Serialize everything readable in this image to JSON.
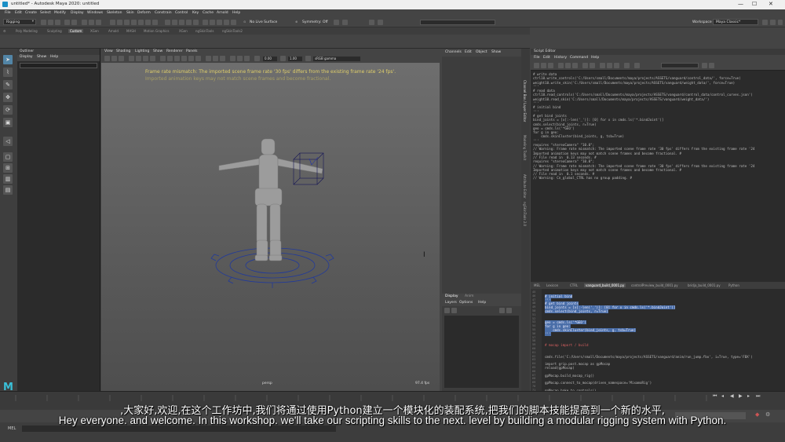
{
  "window": {
    "title": "untitled* - Autodesk Maya 2020: untitled",
    "controls": [
      "—",
      "☐",
      "✕"
    ]
  },
  "menubar": {
    "items": [
      "File",
      "Edit",
      "Create",
      "Select",
      "Modify",
      "Display",
      "Windows",
      "Skeleton",
      "Skin",
      "Deform",
      "Constrain",
      "Control",
      "Key",
      "Cache",
      "Arnold",
      "Help"
    ]
  },
  "statusline": {
    "mode": "Rigging",
    "live_surface": "No Live Surface",
    "symmetry": "Symmetry: Off",
    "workspace_label": "Workspace :",
    "workspace_value": "Maya Classic*"
  },
  "shelf_tabs": [
    "Poly Modeling",
    "Sculpting",
    "Custom",
    "XGen",
    "Arnold",
    "MASH",
    "Motion Graphics",
    "XGen",
    "ngSkinTools",
    "ngSkinTools2"
  ],
  "outliner": {
    "title": "Outliner",
    "menu": [
      "Display",
      "Show",
      "Help"
    ]
  },
  "viewport": {
    "menu": [
      "View",
      "Shading",
      "Lighting",
      "Show",
      "Renderer",
      "Panels"
    ],
    "exposure": "0.00",
    "gamma": "1.00",
    "color_space": "sRGB gamma",
    "warning_line1": "Frame rate mismatch: The imported scene frame rate '30 fps' differs from the existing frame rate '24 fps'.",
    "warning_line2": "Imported animation keys may not match scene frames and become fractional.",
    "camera": "persp",
    "fps": "97.4 fps"
  },
  "channelbox": {
    "menu": [
      "Channels",
      "Edit",
      "Object",
      "Show"
    ]
  },
  "sidebar_tabs": [
    "Channel Box / Layer Editor",
    "Modeling Toolkit",
    "Attribute Editor",
    "ngSkinTools 2.0"
  ],
  "layereditor": {
    "tabs": [
      "Display",
      "Anim"
    ],
    "menu": [
      "Layers",
      "Options",
      "Help"
    ]
  },
  "script_editor": {
    "title": "Script Editor",
    "menu": [
      "File",
      "Edit",
      "History",
      "Command",
      "Help"
    ],
    "output_lines": [
      "# write data",
      "ctrl10.write_controls('C:/Users/small/Documents/maya/projects/ASSETS/vanguard/control_data/', force=True)",
      "weight10.write_skin('C:/Users/small/Documents/maya/projects/ASSETS/vanguard/weight_data/', force=True)",
      "'''",
      "",
      "# read data",
      "ctrl10.read_controls('C:/Users/small/Documents/maya/projects/ASSETS/vanguard/control_data/control_curves.json')",
      "weight10.read_skin('C:/Users/small/Documents/maya/projects/ASSETS/vanguard/weight_data/')",
      "'''",
      "",
      "",
      "",
      "",
      "# initial bind",
      "'''",
      "# get bind joints",
      "bind_joints = [x[:-len('_')]: [0] for x in cmds.ls('*.bindJoint')]",
      "cmds.select(bind_joints, r=True)",
      "",
      "",
      "",
      "",
      "geo = cmds.ls('*GEO')",
      "for g in geo:",
      "    cmds.skinCluster(bind_joints, g, tsb=True)",
      "'''",
      "",
      "",
      "requires \"stereoCamera\" \"10.0\";",
      "// Warning: Frame rate mismatch: The imported scene frame rate '30 fps' differs from the existing frame rate '24",
      "Imported animation keys may not match scene frames and become fractional. #",
      "// File read in  0.13 seconds. #",
      "requires \"stereoCamera\" \"10.0\";",
      "// Warning: Frame rate mismatch: The imported scene frame rate '30 fps' differs from the existing frame rate '24",
      "Imported animation keys may not match scene frames and become fractional. #",
      "// File read in  0.1 seconds. #",
      "// Warning: Cn_global_CTRL has no group padding. #"
    ],
    "tabs": [
      "MEL",
      "Lexicon",
      "CTRL",
      "vanguard_build_0001.py",
      "controlPreview_build_0001.py",
      "bridja_build_0001.py",
      "Python"
    ],
    "input_lines": [
      {
        "n": "45",
        "text": "",
        "sel": false
      },
      {
        "n": "46",
        "text": "# initial bind",
        "sel": true
      },
      {
        "n": "47",
        "text": "'''",
        "sel": true
      },
      {
        "n": "48",
        "text": "# get bind joints",
        "sel": true
      },
      {
        "n": "49",
        "text": "bind_joints = [x[:-len('_')]: [0] for x in cmds.ls('*.bindJoint')]",
        "sel": true
      },
      {
        "n": "50",
        "text": "cmds.select(bind_joints, r=True)",
        "sel": true
      },
      {
        "n": "51",
        "text": "",
        "sel": false
      },
      {
        "n": "52",
        "text": "",
        "sel": false
      },
      {
        "n": "53",
        "text": "geo = cmds.ls('*GEO')",
        "sel": true
      },
      {
        "n": "54",
        "text": "for g in geo:",
        "sel": true
      },
      {
        "n": "55",
        "text": "    cmds.skinCluster(bind_joints, g, tsb=True)",
        "sel": true
      },
      {
        "n": "56",
        "text": "'''",
        "sel": true
      },
      {
        "n": "57",
        "text": "",
        "sel": false
      },
      {
        "n": "58",
        "text": "",
        "sel": false
      },
      {
        "n": "59",
        "text": "# mocap import / build",
        "sel": false
      },
      {
        "n": "60",
        "text": "",
        "sel": false
      },
      {
        "n": "61",
        "text": "",
        "sel": false
      },
      {
        "n": "62",
        "text": "cmds.file('C:/Users/small/Documents/maya/projects/ASSETS/vanguard/anim/run_jump.fbx', i=True, type='FBX')",
        "sel": false
      },
      {
        "n": "63",
        "text": "",
        "sel": false
      },
      {
        "n": "64",
        "text": "import grip.post.mocap as gpMocap",
        "sel": false
      },
      {
        "n": "65",
        "text": "reload(gpMocap)",
        "sel": false
      },
      {
        "n": "66",
        "text": "",
        "sel": false
      },
      {
        "n": "67",
        "text": "gpMocap.build_mocap_rig()",
        "sel": false
      },
      {
        "n": "68",
        "text": "",
        "sel": false
      },
      {
        "n": "69",
        "text": "gpMocap.connect_to_mocap(driven_namespace='MixamoRig')",
        "sel": false
      },
      {
        "n": "70",
        "text": "",
        "sel": false
      },
      {
        "n": "71",
        "text": "gpMocap.bake_to_controls()",
        "sel": false
      }
    ]
  },
  "melbar": {
    "label": "MEL"
  },
  "subtitles": {
    "zh": ",大家好,欢迎,在这个工作坊中,我们将通过使用Python建立一个模块化的装配系统,把我们的脚本技能提高到一个新的水平,",
    "en": "Hey everyone. and welcome. In this workshop. we'll take our scripting skills to the next. level by building a modular rigging system with Python."
  },
  "colors": {
    "warning": "#e0cf6a",
    "selection": "#4a6ea8",
    "maya_logo": "#39c0d8"
  }
}
